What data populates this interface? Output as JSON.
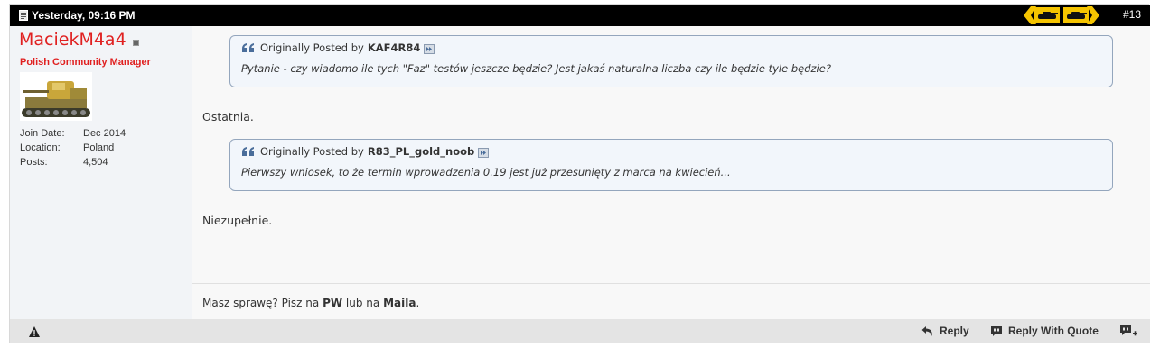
{
  "header": {
    "date": "Yesterday, 09:16 PM",
    "post_number": "#13",
    "icons": {
      "date": "document-icon",
      "badge": "tank-badge-icon"
    }
  },
  "user": {
    "name": "MaciekM4a4",
    "title": "Polish Community Manager",
    "stats": [
      {
        "label": "Join Date:",
        "value": "Dec 2014"
      },
      {
        "label": "Location:",
        "value": "Poland"
      },
      {
        "label": "Posts:",
        "value": "4,504"
      }
    ],
    "colors": {
      "name": "#e02020",
      "title": "#e02020"
    }
  },
  "quotes": [
    {
      "prefix": "Originally Posted by",
      "author": "KAF4R84",
      "text": "Pytanie - czy wiadomo ile tych \"Faz\" testów jeszcze będzie? Jest jakaś naturalna liczba czy ile będzie tyle będzie?"
    },
    {
      "prefix": "Originally Posted by",
      "author": "R83_PL_gold_noob",
      "text": "Pierwszy wniosek, to że termin wprowadzenia 0.19 jest już przesunięty z marca na kwiecień..."
    }
  ],
  "messages": [
    "Ostatnia.",
    "Niezupełnie."
  ],
  "signature": {
    "part1": "Masz sprawę? Pisz na ",
    "pw": "PW",
    "part2": " lub na ",
    "maila": "Maila",
    "part3": "."
  },
  "footer": {
    "reply_label": "Reply",
    "reply_with_quote_label": "Reply With Quote",
    "icons": {
      "report": "warning-icon",
      "reply": "reply-arrow-icon",
      "quote": "quote-bubble-icon",
      "multiquote": "multiquote-plus-icon"
    }
  }
}
